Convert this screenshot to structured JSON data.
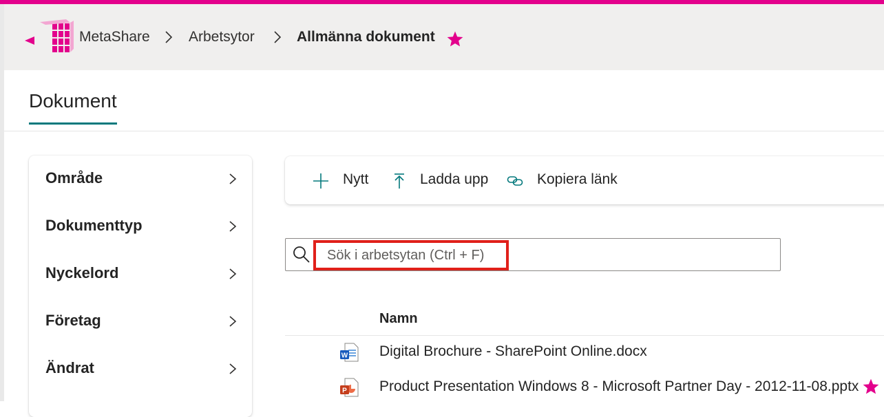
{
  "header": {
    "breadcrumbs": [
      {
        "label": "MetaShare"
      },
      {
        "label": "Arbetsytor"
      },
      {
        "label": "Allmänna dokument"
      }
    ],
    "favorite_icon": "star-icon"
  },
  "tabs": [
    {
      "label": "Dokument",
      "selected": true
    }
  ],
  "filters": [
    {
      "label": "Område"
    },
    {
      "label": "Dokumenttyp"
    },
    {
      "label": "Nyckelord"
    },
    {
      "label": "Företag"
    },
    {
      "label": "Ändrat"
    }
  ],
  "command_bar": {
    "new_label": "Nytt",
    "upload_label": "Ladda upp",
    "copy_link_label": "Kopiera länk"
  },
  "search": {
    "placeholder": "Sök i arbetsytan (Ctrl + F)",
    "value": ""
  },
  "table": {
    "column_name": "Namn",
    "rows": [
      {
        "name": "Digital Brochure - SharePoint Online.docx",
        "type_icon": "word-icon",
        "favorite": false
      },
      {
        "name": "Product Presentation Windows 8 - Microsoft Partner Day - 2012-11-08.pptx",
        "type_icon": "powerpoint-icon",
        "favorite": true
      }
    ]
  },
  "colors": {
    "accent": "#e3008c",
    "tab_underline": "#03787c",
    "highlight_box": "#e0201a"
  }
}
